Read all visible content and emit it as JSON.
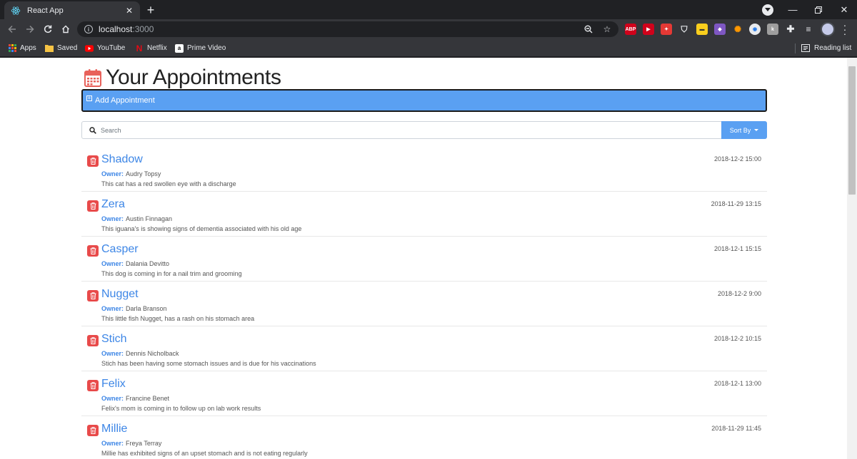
{
  "browser": {
    "tab_title": "React App",
    "url_host": "localhost",
    "url_port": ":3000",
    "bookmarks": [
      {
        "label": "Apps",
        "icon": "apps-grid-icon"
      },
      {
        "label": "Saved",
        "icon": "folder-icon"
      },
      {
        "label": "YouTube",
        "icon": "youtube-icon"
      },
      {
        "label": "Netflix",
        "icon": "netflix-icon"
      },
      {
        "label": "Prime Video",
        "icon": "amazon-icon"
      }
    ],
    "reading_list": "Reading list",
    "extensions": [
      {
        "name": "adblock-plus-icon",
        "text": "ABP",
        "color": "#d0021b"
      },
      {
        "name": "ext-red-icon",
        "text": "",
        "color": "#d0021b"
      },
      {
        "name": "ext-red2-icon",
        "text": "",
        "color": "#e53935"
      },
      {
        "name": "ext-shield-icon",
        "text": "",
        "color": "#e8eaed"
      },
      {
        "name": "ext-yellow-icon",
        "text": "",
        "color": "#f9ce1d"
      },
      {
        "name": "ext-purple-icon",
        "text": "",
        "color": "#7e57c2"
      },
      {
        "name": "ext-colorful-icon",
        "text": "",
        "color": "#ff9800"
      },
      {
        "name": "ext-circle-icon",
        "text": "",
        "color": "#e8eaed"
      },
      {
        "name": "ext-gray-icon",
        "text": "",
        "color": "#9e9e9e"
      }
    ]
  },
  "page": {
    "title": "Your Appointments",
    "add_label": "Add Appointment",
    "search_placeholder": "Search",
    "sort_label": "Sort By",
    "colors": {
      "accent": "#5aa0f2",
      "name": "#3d86e6",
      "delete": "#e84a4a",
      "calendar": "#e8615a"
    }
  },
  "appointments": [
    {
      "pet": "Shadow",
      "date": "2018-12-2 15:00",
      "owner_label": "Owner:",
      "owner": "Audry Topsy",
      "notes": "This cat has a red swollen eye with a discharge"
    },
    {
      "pet": "Zera",
      "date": "2018-11-29 13:15",
      "owner_label": "Owner:",
      "owner": "Austin Finnagan",
      "notes": "This iguana's is showing signs of dementia associated with his old age"
    },
    {
      "pet": "Casper",
      "date": "2018-12-1 15:15",
      "owner_label": "Owner:",
      "owner": "Dalania Devitto",
      "notes": "This dog is coming in for a nail trim and grooming"
    },
    {
      "pet": "Nugget",
      "date": "2018-12-2 9:00",
      "owner_label": "Owner:",
      "owner": "Darla Branson",
      "notes": "This little fish Nugget, has a rash on his stomach area"
    },
    {
      "pet": "Stich",
      "date": "2018-12-2 10:15",
      "owner_label": "Owner:",
      "owner": "Dennis Nicholback",
      "notes": "Stich has been having some stomach issues and is due for his vaccinations"
    },
    {
      "pet": "Felix",
      "date": "2018-12-1 13:00",
      "owner_label": "Owner:",
      "owner": "Francine Benet",
      "notes": "Felix's mom is coming in to follow up on lab work results"
    },
    {
      "pet": "Millie",
      "date": "2018-11-29 11:45",
      "owner_label": "Owner:",
      "owner": "Freya Terray",
      "notes": "Millie has exhibited signs of an upset stomach and is not eating regularly"
    }
  ]
}
